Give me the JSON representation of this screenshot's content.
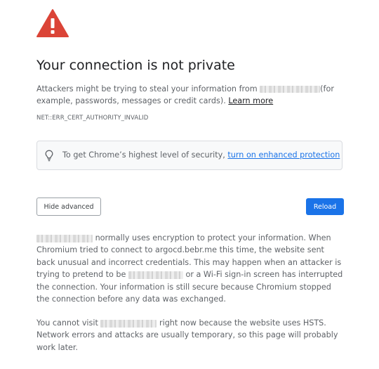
{
  "interstitial": {
    "title": "Your connection is not private",
    "intro_prefix": "Attackers might be trying to steal your information from",
    "intro_suffix": "(for example, passwords, messages or credit cards).",
    "learn_more": "Learn more",
    "error_code": "NET::ERR_CERT_AUTHORITY_INVALID",
    "icons": {
      "warning": "warning-triangle-icon",
      "bulb": "lightbulb-icon"
    },
    "colors": {
      "warning": "#db4437",
      "accent": "#1a73e8"
    }
  },
  "promo": {
    "text": "To get Chrome’s highest level of security,",
    "link": "turn on enhanced protection"
  },
  "buttons": {
    "hide_advanced": "Hide advanced",
    "reload": "Reload"
  },
  "details": {
    "p1_part1": "normally uses encryption to protect your information. When Chromium tried to connect to argocd.bebr.me this time, the website sent back unusual and incorrect credentials. This may happen when an attacker is trying to pretend to be",
    "p1_part2": "or a Wi-Fi sign-in screen has interrupted the connection. Your information is still secure because Chromium stopped the connection before any data was exchanged.",
    "p2_part1": "You cannot visit",
    "p2_part2": "right now because the website uses HSTS. Network errors and attacks are usually temporary, so this page will probably work later."
  }
}
